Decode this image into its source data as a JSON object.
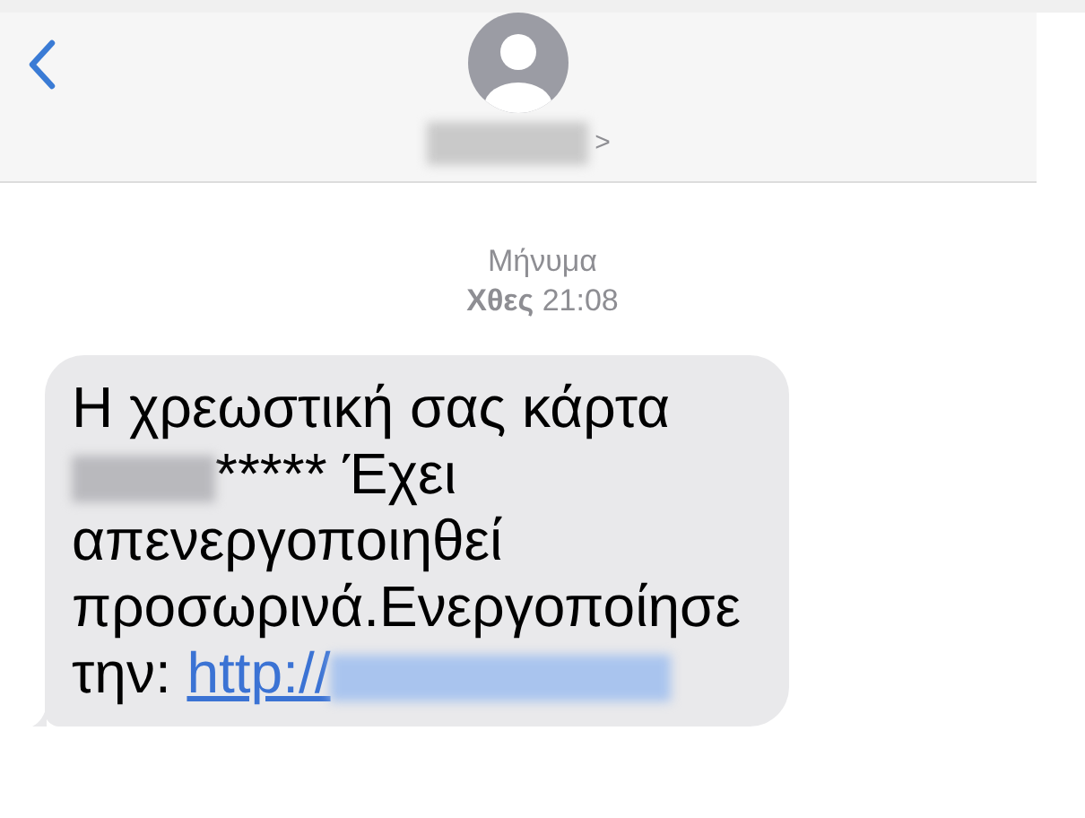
{
  "header": {
    "contact_chevron": ">"
  },
  "conversation_header": {
    "label": "Μήνυμα",
    "day": "Χθες",
    "time": "21:08"
  },
  "message": {
    "text_before": "Η χρεωστική σας κάρτα",
    "text_after": "***** Έχει απενεργοποιηθεί προσωρινά.Ενεργοποίησε την:",
    "link": "http://"
  }
}
